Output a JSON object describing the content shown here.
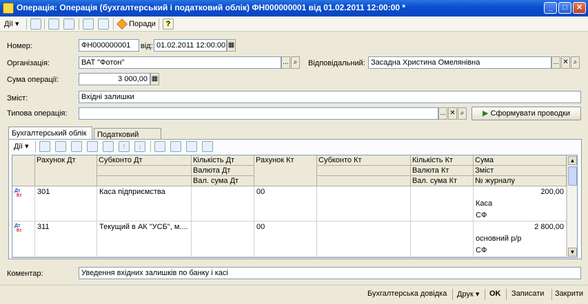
{
  "window": {
    "title": "Операція: Операція (бухгалтерський і податковий облік) ФН000000001 від 01.02.2011 12:00:00 *",
    "min_label": "_",
    "max_label": "□",
    "close_label": "✕"
  },
  "toolbar": {
    "actions_label": "Дії",
    "actions_arrow": "▾",
    "tips_label": "Поради",
    "help_label": "?"
  },
  "form": {
    "number_label": "Номер:",
    "number_value": "ФН000000001",
    "date_label": "від:",
    "date_value": "01.02.2011 12:00:00",
    "org_label": "Організація:",
    "org_value": "ВАТ \"Фотон\"",
    "responsible_label": "Відповідальний:",
    "responsible_value": "Засадна Христина Омелянівна",
    "amount_label": "Сума операції:",
    "amount_value": "3 000,00",
    "content_label": "Зміст:",
    "content_value": "Вхідні залишки",
    "typical_label": "Типова операція:",
    "typical_value": "",
    "generate_button": "Сформувати проводки",
    "comment_label": "Коментар:",
    "comment_value": "Уведення вхідних залишків по банку і касі"
  },
  "field_buttons": {
    "ellipsis": "...",
    "clear": "✕",
    "search": "⌕"
  },
  "tabs": [
    "Бухгалтерський облік",
    "Податковий облік"
  ],
  "grid_toolbar": {
    "actions_label": "Дії",
    "actions_arrow": "▾"
  },
  "grid": {
    "headers": {
      "account_dt": "Рахунок Дт",
      "subconto_dt": "Субконто Дт",
      "qty_dt": "Кількість Дт",
      "currency_dt": "Валюта Дт",
      "cur_amount_dt": "Вал. сума Дт",
      "account_kt": "Рахунок Кт",
      "subconto_kt": "Субконто Кт",
      "qty_kt": "Кількість Кт",
      "currency_kt": "Валюта Кт",
      "cur_amount_kt": "Вал. сума Кт",
      "sum": "Сума",
      "content": "Зміст",
      "journal_no": "№ журналу"
    },
    "row_badge": {
      "dt": "Дт",
      "kt": "Кт"
    },
    "rows": [
      {
        "account_dt": "301",
        "subconto_dt": "Каса підприємства",
        "account_kt": "00",
        "sum": "200,00",
        "content": "Каса",
        "journal_no": "СФ"
      },
      {
        "account_dt": "311",
        "subconto_dt": "Текущий в АК \"УСБ\", м....",
        "account_kt": "00",
        "sum": "2 800,00",
        "content": "основний р/р",
        "journal_no": "СФ"
      }
    ]
  },
  "scrollbar": {
    "up": "▲",
    "down": "▼"
  },
  "statusbar": {
    "report_label": "Бухгалтерська довідка",
    "print_label": "Друк",
    "print_arrow": "▾",
    "ok_label": "OK",
    "save_label": "Записати",
    "close_label": "Закрити"
  }
}
